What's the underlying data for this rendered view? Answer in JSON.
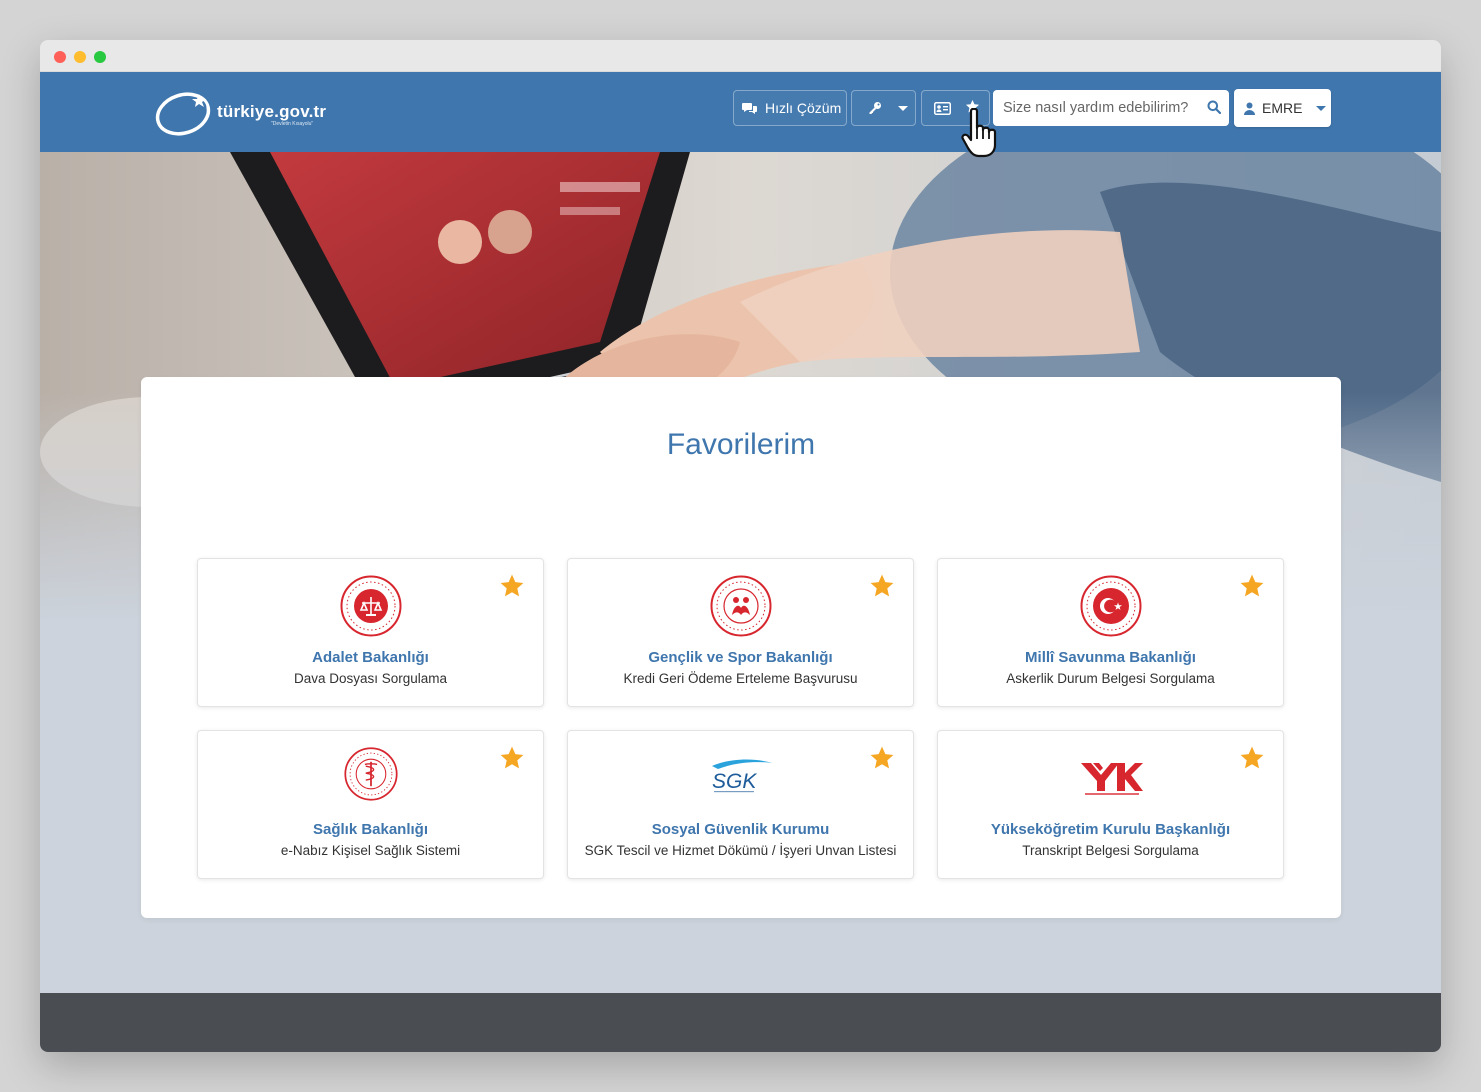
{
  "header": {
    "logo_text": "türkiye.gov.tr",
    "logo_tagline": "\"Devletin Kısayolu\"",
    "quick_solution_label": "Hızlı Çözüm",
    "search_placeholder": "Size nasıl yardım edebilirim?",
    "user_name": "EMRE"
  },
  "main": {
    "title": "Favorilerim",
    "favorites": [
      {
        "org": "Adalet Bakanlığı",
        "service": "Dava Dosyası Sorgulama",
        "logo": "justice-ministry-logo"
      },
      {
        "org": "Gençlik ve Spor Bakanlığı",
        "service": "Kredi Geri Ödeme Erteleme Başvurusu",
        "logo": "youth-sports-ministry-logo"
      },
      {
        "org": "Millî Savunma Bakanlığı",
        "service": "Askerlik Durum Belgesi Sorgulama",
        "logo": "defense-ministry-logo"
      },
      {
        "org": "Sağlık Bakanlığı",
        "service": "e-Nabız Kişisel Sağlık Sistemi",
        "logo": "health-ministry-logo"
      },
      {
        "org": "Sosyal Güvenlik Kurumu",
        "service": "SGK Tescil ve Hizmet Dökümü / İşyeri Unvan Listesi",
        "logo": "sgk-logo"
      },
      {
        "org": "Yükseköğretim Kurulu Başkanlığı",
        "service": "Transkript Belgesi Sorgulama",
        "logo": "yok-logo"
      }
    ]
  },
  "colors": {
    "brand": "#3f76ad",
    "star": "#f5a623",
    "logo_red": "#d7262e",
    "footer": "#4a4e52"
  }
}
